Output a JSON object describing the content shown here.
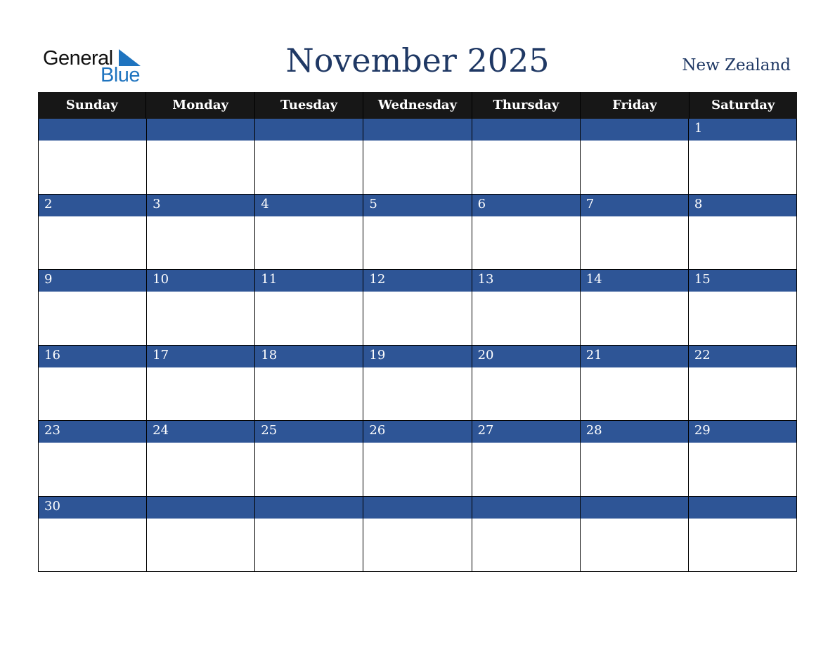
{
  "logo": {
    "word1": "General",
    "word2": "Blue",
    "icon": "triangle-flag-icon"
  },
  "header": {
    "title": "November 2025",
    "country": "New Zealand"
  },
  "calendar": {
    "weekdays": [
      "Sunday",
      "Monday",
      "Tuesday",
      "Wednesday",
      "Thursday",
      "Friday",
      "Saturday"
    ],
    "weeks": [
      [
        "",
        "",
        "",
        "",
        "",
        "",
        "1"
      ],
      [
        "2",
        "3",
        "4",
        "5",
        "6",
        "7",
        "8"
      ],
      [
        "9",
        "10",
        "11",
        "12",
        "13",
        "14",
        "15"
      ],
      [
        "16",
        "17",
        "18",
        "19",
        "20",
        "21",
        "22"
      ],
      [
        "23",
        "24",
        "25",
        "26",
        "27",
        "28",
        "29"
      ],
      [
        "30",
        "",
        "",
        "",
        "",
        "",
        ""
      ]
    ]
  },
  "colors": {
    "title": "#1f3864",
    "header_bg": "#171717",
    "date_band": "#2e5596",
    "logo_blue": "#1f74bf"
  }
}
